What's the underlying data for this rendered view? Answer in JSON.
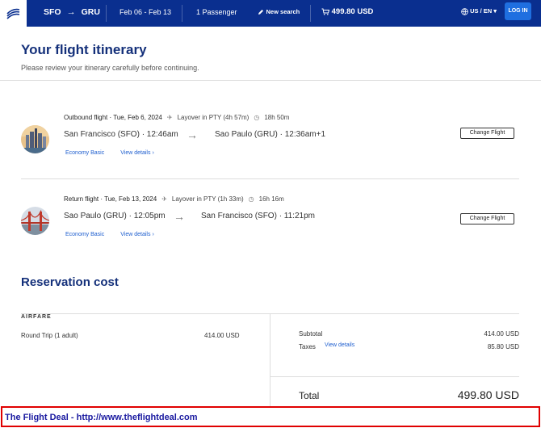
{
  "topbar": {
    "origin": "SFO",
    "destination": "GRU",
    "dates": "Feb 06 - Feb 13",
    "passengers": "1 Passenger",
    "new_search": "New search",
    "cart_total": "499.80 USD",
    "locale": "US / EN",
    "login": "LOG IN"
  },
  "page": {
    "title": "Your flight itinerary",
    "subtitle": "Please review your itinerary carefully before continuing."
  },
  "flights": [
    {
      "label": "Outbound flight · Tue, Feb 6, 2024",
      "layover": "Layover in PTY (4h 57m)",
      "duration": "18h 50m",
      "from": "San Francisco (SFO) · 12:46am",
      "to": "Sao Paulo (GRU) · 12:36am+1",
      "fare": "Economy Basic",
      "details": "View details",
      "change": "Change Flight"
    },
    {
      "label": "Return flight · Tue, Feb 13, 2024",
      "layover": "Layover in PTY (1h 33m)",
      "duration": "16h 16m",
      "from": "Sao Paulo (GRU) · 12:05pm",
      "to": "San Francisco (SFO) · 11:21pm",
      "fare": "Economy Basic",
      "details": "View details",
      "change": "Change Flight"
    }
  ],
  "reservation": {
    "title": "Reservation cost",
    "airfare_label": "AIRFARE",
    "round_trip": "Round Trip (1 adult)",
    "round_trip_value": "414.00 USD",
    "subtotal_label": "Subtotal",
    "subtotal_value": "414.00 USD",
    "taxes_label": "Taxes",
    "taxes_link": "View details",
    "taxes_value": "85.80 USD",
    "total_label": "Total",
    "total_value": "499.80 USD"
  },
  "banner": {
    "text": "The Flight Deal - http://www.theflightdeal.com"
  },
  "colors": {
    "topbar": "#0a2f8f",
    "heading": "#14307a",
    "link": "#1f5fcf",
    "banner_border": "#e00000"
  }
}
